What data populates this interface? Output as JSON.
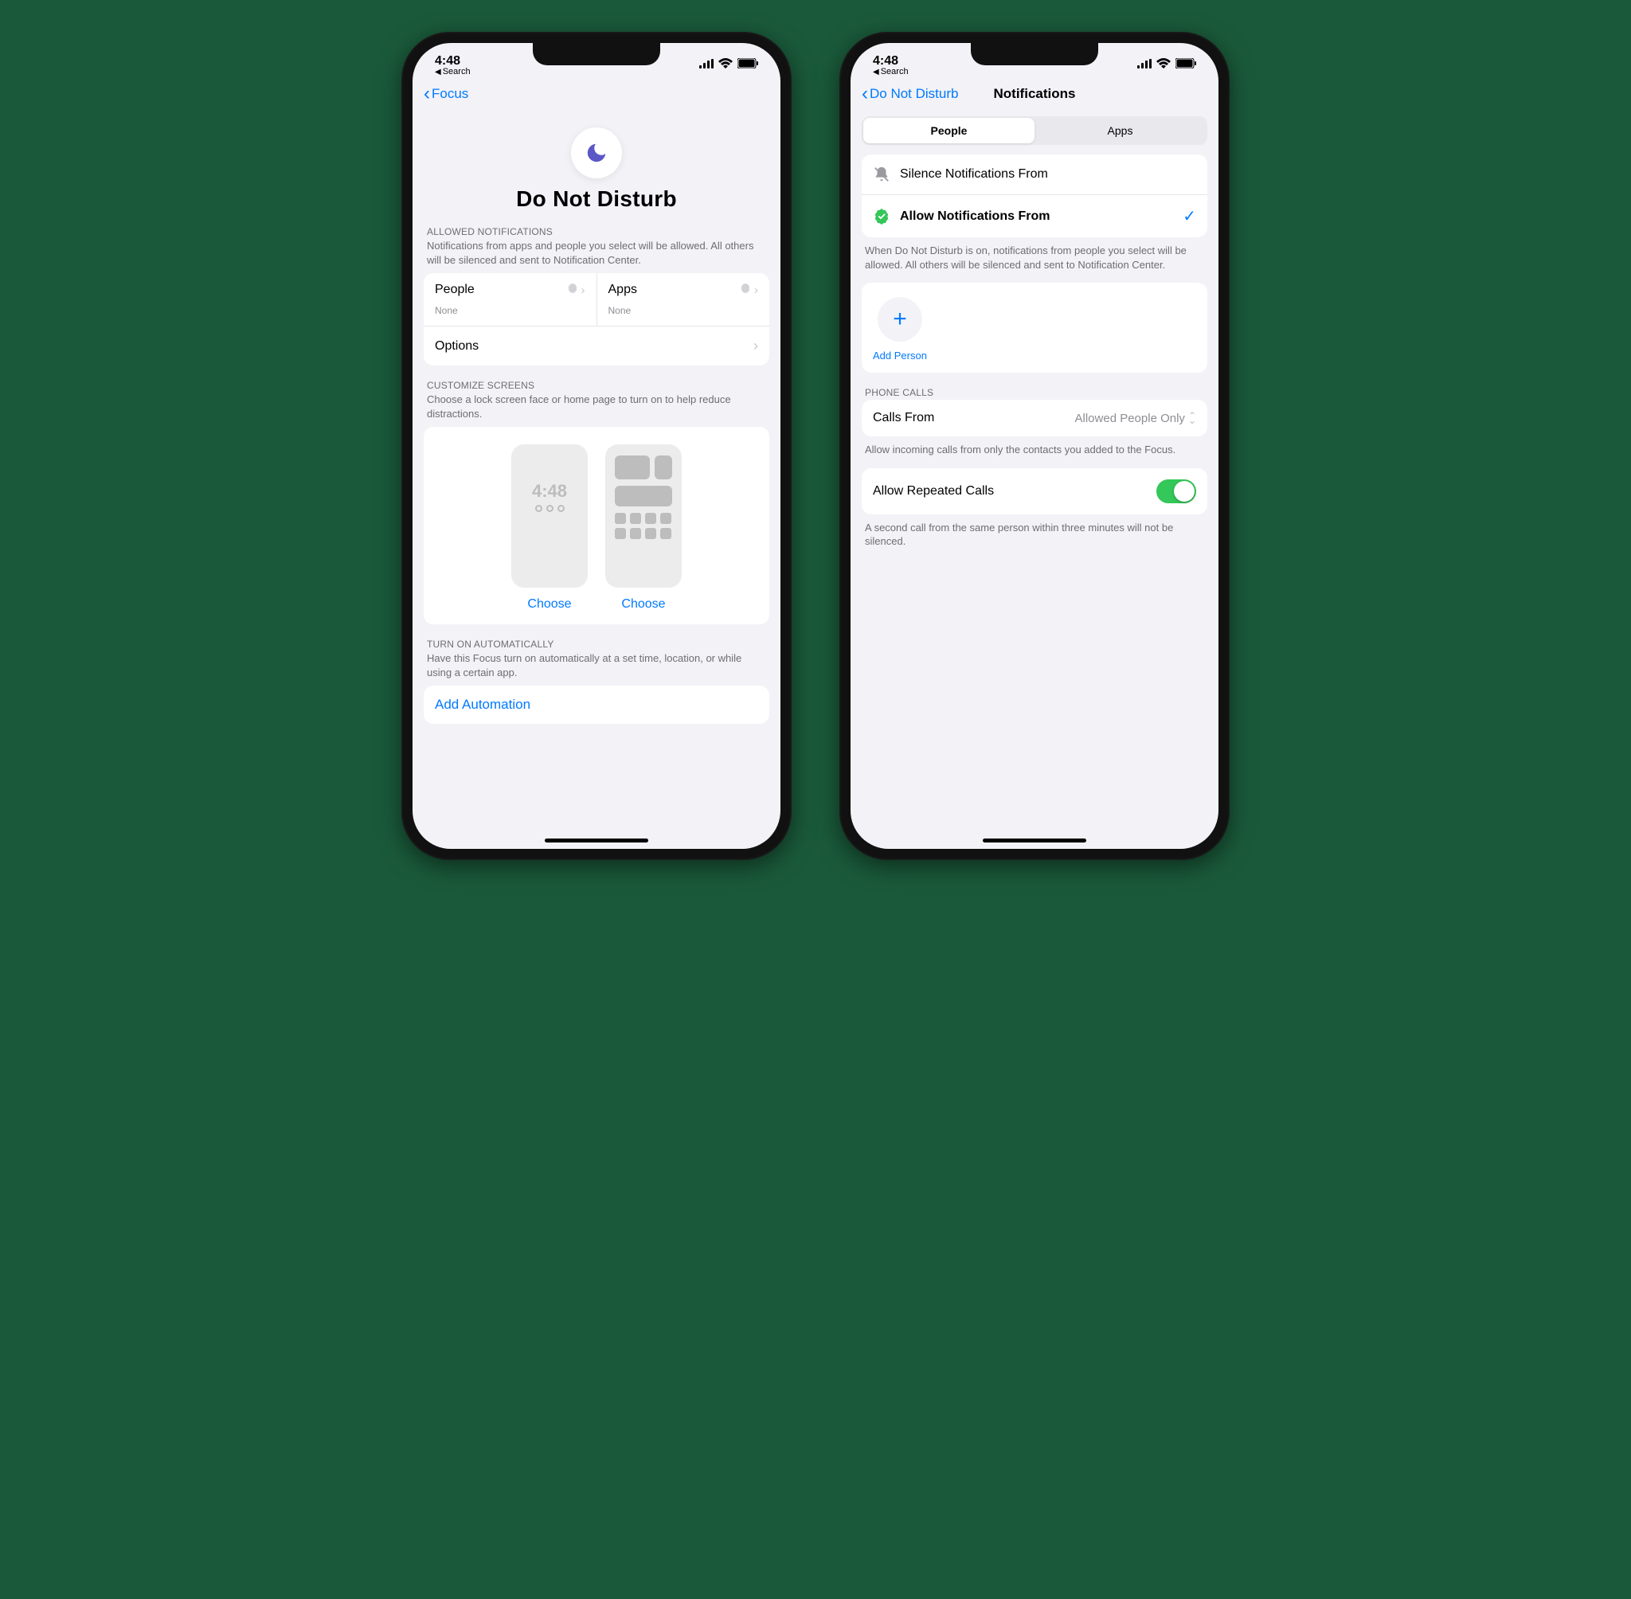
{
  "status": {
    "time": "4:48",
    "breadcrumb": "Search"
  },
  "left": {
    "back": "Focus",
    "title": "Do Not Disturb",
    "allowed": {
      "header": "ALLOWED NOTIFICATIONS",
      "desc": "Notifications from apps and people you select will be allowed. All others will be silenced and sent to Notification Center.",
      "people_label": "People",
      "people_value": "None",
      "apps_label": "Apps",
      "apps_value": "None",
      "options_label": "Options"
    },
    "customize": {
      "header": "CUSTOMIZE SCREENS",
      "desc": "Choose a lock screen face or home page to turn on to help reduce distractions.",
      "mock_time": "4:48",
      "choose_label": "Choose"
    },
    "auto": {
      "header": "TURN ON AUTOMATICALLY",
      "desc": "Have this Focus turn on automatically at a set time, location, or while using a certain app.",
      "add_label": "Add Automation"
    }
  },
  "right": {
    "back": "Do Not Disturb",
    "title": "Notifications",
    "segments": {
      "people": "People",
      "apps": "Apps"
    },
    "silence_label": "Silence Notifications From",
    "allow_label": "Allow Notifications From",
    "mode_desc": "When Do Not Disturb is on, notifications from people you select will be allowed. All others will be silenced and sent to Notification Center.",
    "add_person_label": "Add Person",
    "phone_calls_header": "PHONE CALLS",
    "calls_from_label": "Calls From",
    "calls_from_value": "Allowed People Only",
    "calls_desc": "Allow incoming calls from only the contacts you added to the Focus.",
    "repeated_label": "Allow Repeated Calls",
    "repeated_desc": "A second call from the same person within three minutes will not be silenced."
  }
}
